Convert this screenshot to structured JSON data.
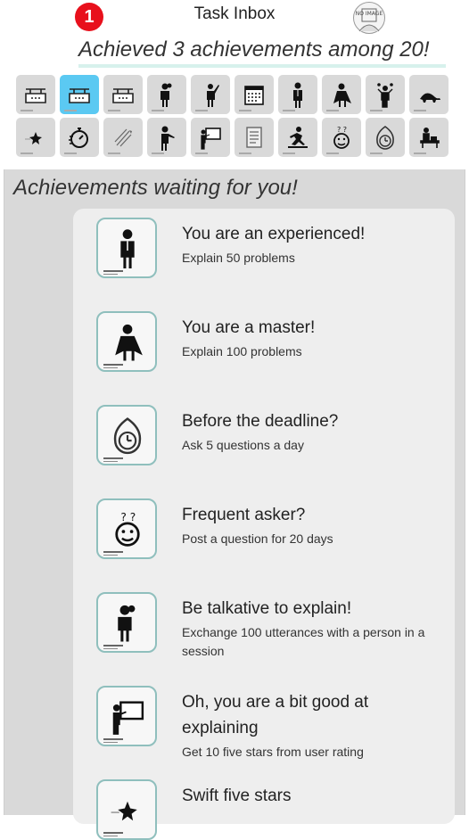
{
  "header": {
    "notification_count": "1",
    "title": "Task Inbox",
    "avatar_text": "NO IMAGE"
  },
  "summary": "Achieved 3 achievements among 20!",
  "grid_icons": [
    {
      "icon": "signboard-icon",
      "selected": false
    },
    {
      "icon": "signboard-icon",
      "selected": true
    },
    {
      "icon": "signboard-icon",
      "selected": false
    },
    {
      "icon": "person-talking-icon",
      "selected": false
    },
    {
      "icon": "person-pointing-up-icon",
      "selected": false
    },
    {
      "icon": "calendar-icon",
      "selected": false
    },
    {
      "icon": "businessman-icon",
      "selected": false
    },
    {
      "icon": "caped-hero-icon",
      "selected": false
    },
    {
      "icon": "juggler-icon",
      "selected": false
    },
    {
      "icon": "turtle-icon",
      "selected": false
    },
    {
      "icon": "shooting-star-icon",
      "selected": false
    },
    {
      "icon": "stopwatch-icon",
      "selected": false
    },
    {
      "icon": "comet-icon",
      "selected": false
    },
    {
      "icon": "person-pointing-icon",
      "selected": false
    },
    {
      "icon": "whiteboard-icon",
      "selected": false
    },
    {
      "icon": "document-icon",
      "selected": false
    },
    {
      "icon": "runner-icon",
      "selected": false
    },
    {
      "icon": "puzzled-face-icon",
      "selected": false
    },
    {
      "icon": "clock-flame-icon",
      "selected": false
    },
    {
      "icon": "desk-worker-icon",
      "selected": false
    }
  ],
  "waiting_heading": "Achievements waiting for you!",
  "achievements": [
    {
      "icon": "businessman-icon",
      "title": "You are an experienced!",
      "desc": "Explain 50 problems"
    },
    {
      "icon": "caped-hero-icon",
      "title": "You are a master!",
      "desc": "Explain 100 problems"
    },
    {
      "icon": "clock-flame-icon",
      "title": "Before the deadline?",
      "desc": "Ask 5 questions a day"
    },
    {
      "icon": "puzzled-face-icon",
      "title": "Frequent asker?",
      "desc": "Post a question for 20 days"
    },
    {
      "icon": "person-talking-icon",
      "title": "Be talkative to explain!",
      "desc": "Exchange 100 utterances with a person in a session"
    },
    {
      "icon": "whiteboard-icon",
      "title": "Oh, you are a bit good at explaining",
      "desc": "Get 10 five stars from user rating"
    },
    {
      "icon": "shooting-star-icon",
      "title": "Swift five stars",
      "desc": ""
    }
  ]
}
